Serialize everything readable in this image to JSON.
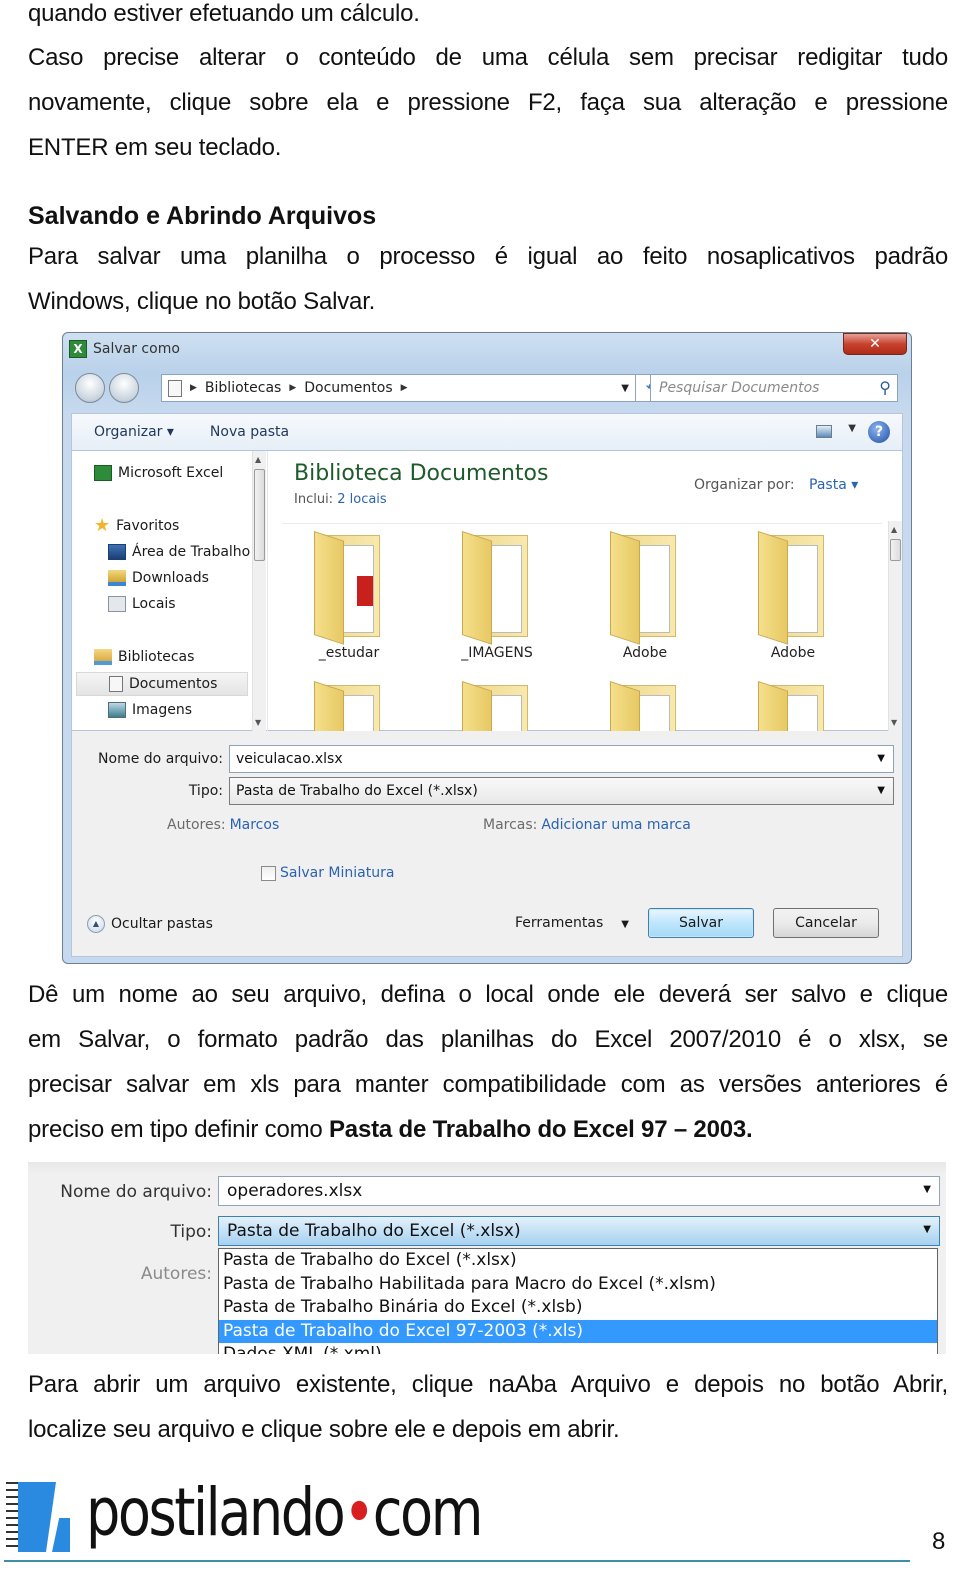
{
  "paragraphs": {
    "p0": "quando estiver efetuando um cálculo.",
    "p1_l1": "Caso precise alterar o conteúdo de uma célula sem precisar redigitar tudo",
    "p1_l2": "novamente, clique sobre ela e pressione F2, faça sua alteração e pressione",
    "p1_l3": "ENTER em seu teclado.",
    "heading": "Salvando e Abrindo Arquivos",
    "p2_l1": "Para salvar uma planilha o processo é igual ao feito nosaplicativos padrão",
    "p2_l2": "Windows, clique no botão Salvar.",
    "p3_l1": "Dê um nome ao seu arquivo, defina o local onde ele deverá ser salvo e clique",
    "p3_l2": "em Salvar, o formato padrão das planilhas do Excel 2007/2010 é o xlsx, se",
    "p3_l3": "precisar salvar em xls para manter compatibilidade com as versões anteriores é",
    "p3_l4_prefix": "preciso em tipo definir como ",
    "p3_l4_bold": "Pasta de Trabalho do Excel 97 – 2003.",
    "p4_l1": "Para abrir um arquivo existente, clique naAba Arquivo e depois no botão Abrir,",
    "p4_l2": "localize seu arquivo e clique sobre ele e depois em abrir."
  },
  "dialog": {
    "title": "Salvar como",
    "close_glyph": "✕",
    "breadcrumb": [
      "Bibliotecas",
      "Documentos"
    ],
    "search_placeholder": "Pesquisar Documentos",
    "toolbar": {
      "organize": "Organizar ▾",
      "new_folder": "Nova pasta",
      "help": "?"
    },
    "nav": {
      "items": [
        {
          "label": "Microsoft Excel",
          "icon": "excel-icon"
        },
        {
          "label": "Favoritos",
          "icon": "star-icon"
        },
        {
          "label": "Área de Trabalho",
          "icon": "desktop-icon"
        },
        {
          "label": "Downloads",
          "icon": "downloads-icon"
        },
        {
          "label": "Locais",
          "icon": "recent-places-icon"
        },
        {
          "label": "Bibliotecas",
          "icon": "libraries-icon"
        },
        {
          "label": "Documentos",
          "icon": "documents-icon",
          "selected": true
        },
        {
          "label": "Imagens",
          "icon": "pictures-icon"
        }
      ]
    },
    "library": {
      "title": "Biblioteca Documentos",
      "includes_label": "Inclui:",
      "includes_value": "2 locais",
      "arrange_label": "Organizar por:",
      "arrange_value": "Pasta ▾"
    },
    "folders": [
      "_estudar",
      "_IMAGENS",
      "Adobe",
      "Adobe"
    ],
    "filename_label": "Nome do arquivo:",
    "filename_value": "veiculacao.xlsx",
    "type_label": "Tipo:",
    "type_value": "Pasta de Trabalho do Excel (*.xlsx)",
    "authors_label": "Autores:",
    "authors_value": "Marcos",
    "tags_label": "Marcas:",
    "tags_value": "Adicionar uma marca",
    "thumbnail_label": "Salvar Miniatura",
    "thumbnail_checked": false,
    "hide_folders": "Ocultar pastas",
    "tools": "Ferramentas",
    "save": "Salvar",
    "cancel": "Cancelar"
  },
  "type_dropdown": {
    "filename_label": "Nome do arquivo:",
    "filename_value": "operadores.xlsx",
    "type_label": "Tipo:",
    "type_value": "Pasta de Trabalho do Excel (*.xlsx)",
    "authors_label": "Autores:",
    "options": [
      "Pasta de Trabalho do Excel (*.xlsx)",
      "Pasta de Trabalho Habilitada para Macro do Excel (*.xlsm)",
      "Pasta de Trabalho Binária do Excel (*.xlsb)",
      "Pasta de Trabalho do Excel 97-2003 (*.xls)",
      "Dados XML (*.xml)"
    ],
    "selected_index": 3
  },
  "footer": {
    "logo_text_a": "postilando",
    "logo_dot": "•",
    "logo_text_b": "com",
    "page_number": "8"
  },
  "colors": {
    "link": "#2b63b3",
    "selection": "#3399ff",
    "logo_blue": "#2a8ae0",
    "logo_dot": "#d81f1f"
  }
}
